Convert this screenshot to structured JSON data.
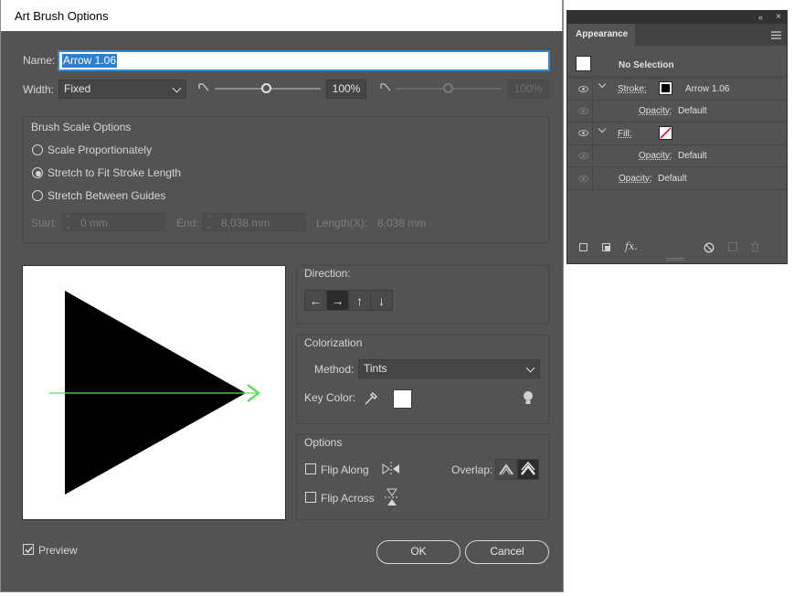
{
  "dialog": {
    "title": "Art Brush Options",
    "name_label": "Name:",
    "name_value": "Arrow 1.06",
    "width_label": "Width:",
    "width_select": "Fixed",
    "width_percent": "100%",
    "width_percent_dim": "100%",
    "width_slider_fraction": 0.5,
    "brush_scale": {
      "heading": "Brush Scale Options",
      "options": [
        "Scale Proportionately",
        "Stretch to Fit Stroke Length",
        "Stretch Between Guides"
      ],
      "selected_index": 1,
      "start_label": "Start:",
      "start_value": "0 mm",
      "end_label": "End:",
      "end_value": "8,038 mm",
      "length_label": "Length(X):",
      "length_value": "8,038 mm"
    },
    "direction": {
      "heading": "Direction:",
      "arrows": [
        "←",
        "→",
        "↑",
        "↓"
      ],
      "selected_index": 1
    },
    "colorization": {
      "heading": "Colorization",
      "method_label": "Method:",
      "method_value": "Tints",
      "key_color_label": "Key Color:",
      "key_color": "#ffffff"
    },
    "options": {
      "heading": "Options",
      "flip_along": "Flip Along",
      "flip_across": "Flip Across",
      "overlap_label": "Overlap:"
    },
    "preview_label": "Preview",
    "preview_checked": true,
    "ok_label": "OK",
    "cancel_label": "Cancel",
    "colors": {
      "background": "#535353",
      "guide_line": "#5ee05e",
      "arrow_fill": "#000000"
    }
  },
  "appearance": {
    "tab_label": "Appearance",
    "no_selection": "No Selection",
    "stroke_label": "Stroke:",
    "stroke_value": "Arrow 1.06",
    "fill_label": "Fill:",
    "opacity_label": "Opacity:",
    "opacity_value": "Default",
    "footer_icons": [
      "new-stroke-icon",
      "new-fill-icon",
      "fx-icon",
      "clear-icon",
      "duplicate-icon",
      "delete-icon"
    ],
    "fx_text": "fx."
  }
}
